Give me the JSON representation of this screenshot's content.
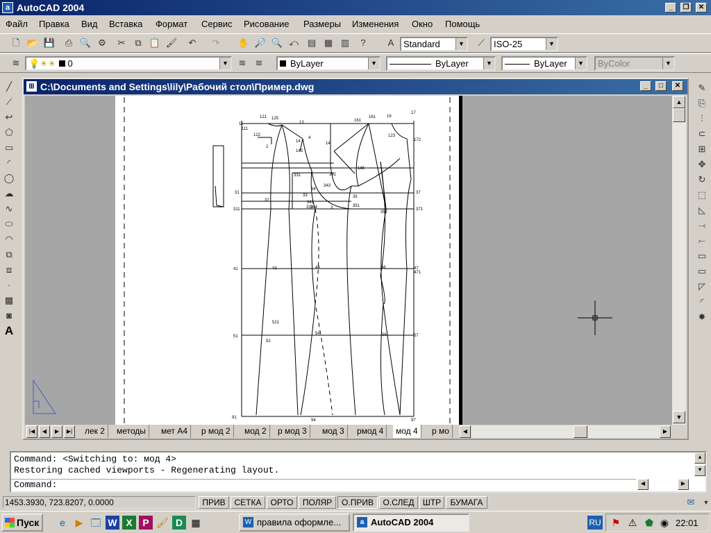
{
  "app": {
    "title": "AutoCAD 2004"
  },
  "menu": [
    "Файл",
    "Правка",
    "Вид",
    "Вставка",
    "Формат",
    "Сервис",
    "Рисование",
    "Размеры",
    "Изменения",
    "Окно",
    "Помощь"
  ],
  "toolbar": {
    "text_style": "Standard",
    "dim_style": "ISO-25",
    "layer": "0",
    "color": "ByLayer",
    "linetype": "ByLayer",
    "lineweight": "ByLayer",
    "plotstyle": "ByColor"
  },
  "document": {
    "title": "C:\\Documents and Settings\\lily\\Рабочий стол\\Пример.dwg"
  },
  "layout_tabs": [
    "лек 2",
    "методы",
    "мет А4",
    "р мод 2",
    "мод 2",
    "р мод 3",
    "мод 3",
    "рмод 4",
    "мод 4",
    "р мо"
  ],
  "active_tab_index": 8,
  "command": {
    "line1": "Command:  <Switching to: мод 4>",
    "line2": "Restoring cached viewports - Regenerating layout.",
    "prompt": "Command:"
  },
  "status": {
    "coords": "1453.3930, 723.8207, 0.0000",
    "toggles": [
      {
        "label": "ПРИВ",
        "on": false
      },
      {
        "label": "СЕТКА",
        "on": false
      },
      {
        "label": "ОРТО",
        "on": false
      },
      {
        "label": "ПОЛЯР",
        "on": false
      },
      {
        "label": "О.ПРИВ",
        "on": true
      },
      {
        "label": "О.СЛЕД",
        "on": false
      },
      {
        "label": "ШТР",
        "on": false
      },
      {
        "label": "БУМАГА",
        "on": false
      }
    ]
  },
  "taskbar": {
    "start": "Пуск",
    "tasks": [
      {
        "label": "правила оформле...",
        "active": false
      },
      {
        "label": "AutoCAD 2004",
        "active": true
      }
    ],
    "lang": "RU",
    "clock": "22:01"
  },
  "drawing_labels": [
    "11",
    "111",
    "121",
    "125",
    "13",
    "14",
    "143",
    "14",
    "2",
    "122",
    "142",
    "331",
    "332",
    "33",
    "34",
    "341",
    "342",
    "343",
    "344",
    "35",
    "351",
    "3",
    "31",
    "311",
    "32",
    "352",
    "36",
    "37",
    "371",
    "161",
    "16",
    "17",
    "172",
    "123",
    "145",
    "41",
    "42",
    "44",
    "46",
    "47",
    "471",
    "51",
    "52",
    "521",
    "54",
    "56",
    "57",
    "91",
    "94",
    "97"
  ]
}
